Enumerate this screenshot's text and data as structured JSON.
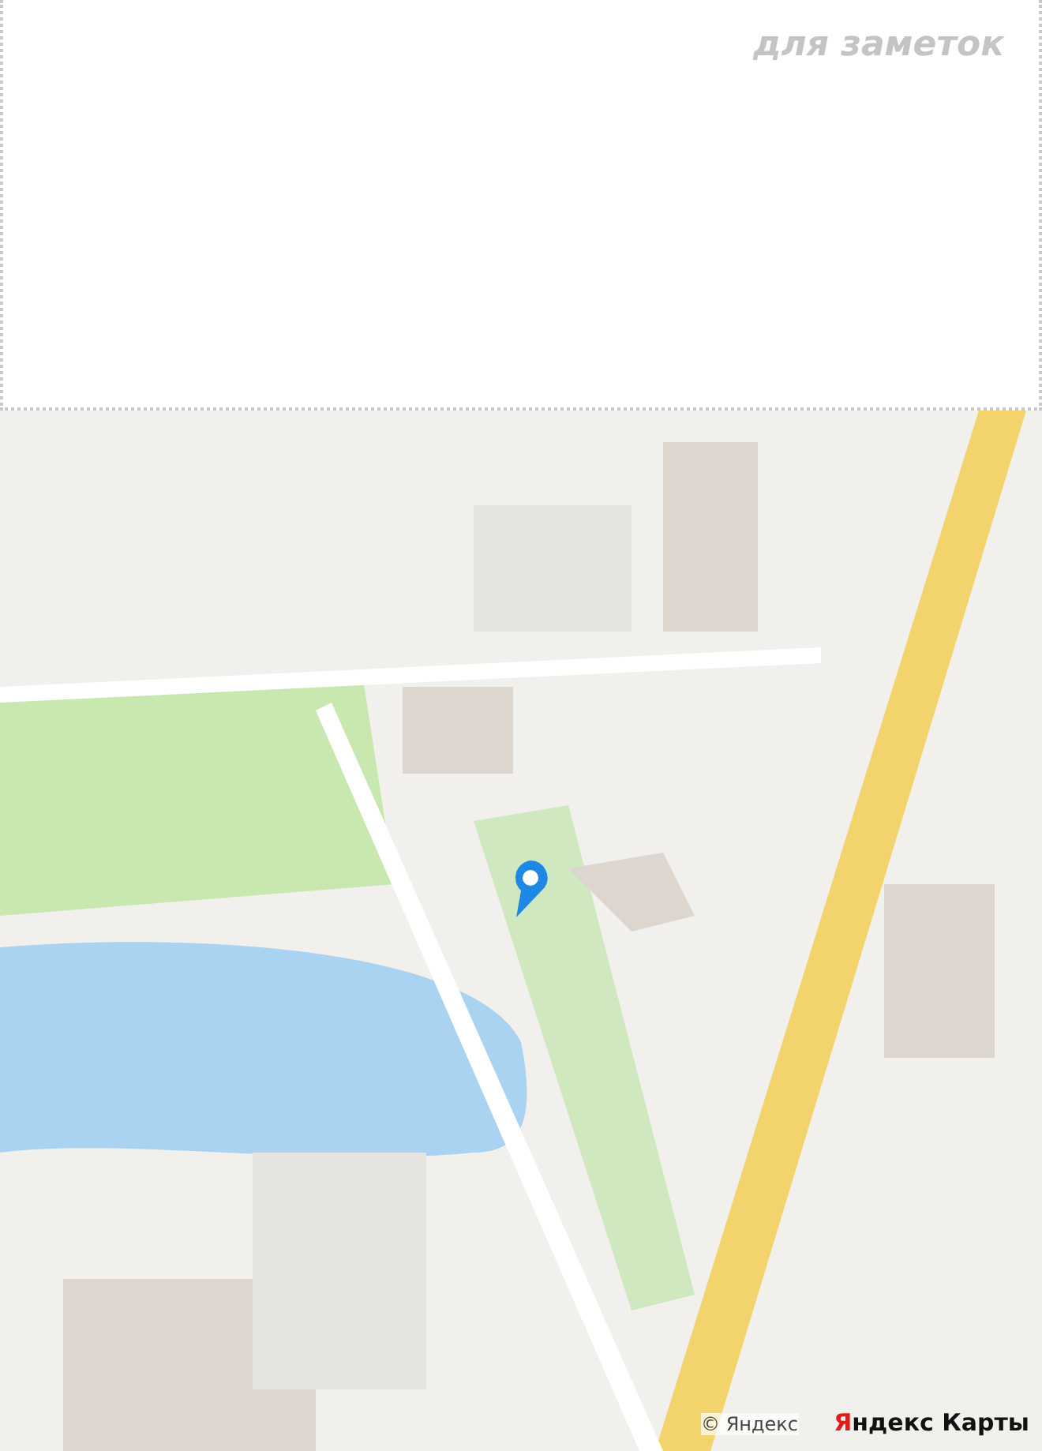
{
  "notes": {
    "placeholder": "для заметок"
  },
  "map": {
    "kind": "picture",
    "attribution": "© Яндекс",
    "logo": "Яндекс Карты"
  }
}
